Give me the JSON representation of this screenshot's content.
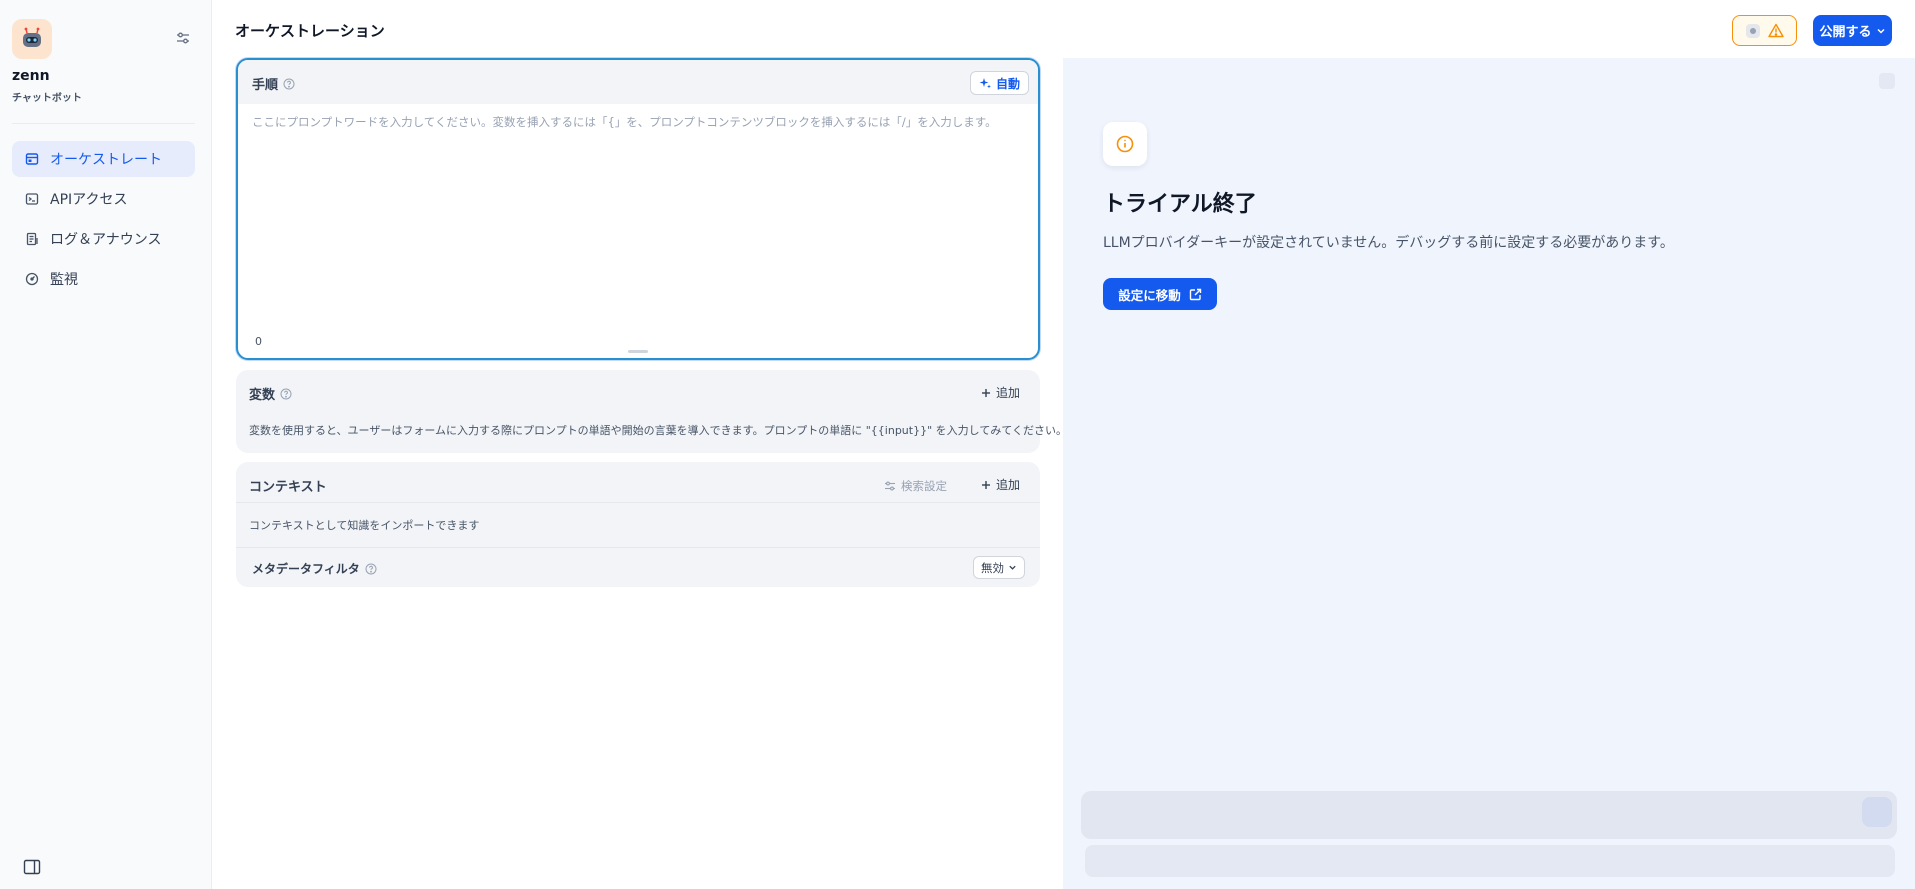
{
  "app": {
    "name": "zenn",
    "type": "チャットボット"
  },
  "sidebar": {
    "items": [
      {
        "label": "オーケストレート",
        "icon": "layout-icon",
        "active": true
      },
      {
        "label": "APIアクセス",
        "icon": "terminal-icon",
        "active": false
      },
      {
        "label": "ログ＆アナウンス",
        "icon": "file-list-icon",
        "active": false
      },
      {
        "label": "監視",
        "icon": "dashboard-icon",
        "active": false
      }
    ]
  },
  "header": {
    "title": "オーケストレーション",
    "publish_label": "公開する"
  },
  "instructions": {
    "title": "手順",
    "auto_label": "自動",
    "placeholder": "ここにプロンプトワードを入力してください。変数を挿入するには「{」を、プロンプトコンテンツブロックを挿入するには「/」を入力します。",
    "char_count": "0"
  },
  "variables": {
    "title": "変数",
    "add_label": "追加",
    "description": "変数を使用すると、ユーザーはフォームに入力する際にプロンプトの単語や開始の言葉を導入できます。プロンプトの単語に \"{{input}}\" を入力してみてください。"
  },
  "context": {
    "title": "コンテキスト",
    "retrieval_label": "検索設定",
    "add_label": "追加",
    "description": "コンテキストとして知識をインポートできます",
    "metadata_filter_label": "メタデータフィルタ",
    "metadata_filter_value": "無効"
  },
  "preview": {
    "trial_title": "トライアル終了",
    "trial_desc": "LLMプロバイダーキーが設定されていません。デバッグする前に設定する必要があります。",
    "goto_settings_label": "設定に移動"
  },
  "colors": {
    "accent": "#155aef",
    "warning": "#f79009",
    "focus_border": "#2a8fcf",
    "preview_bg": "#f0f4fd"
  }
}
